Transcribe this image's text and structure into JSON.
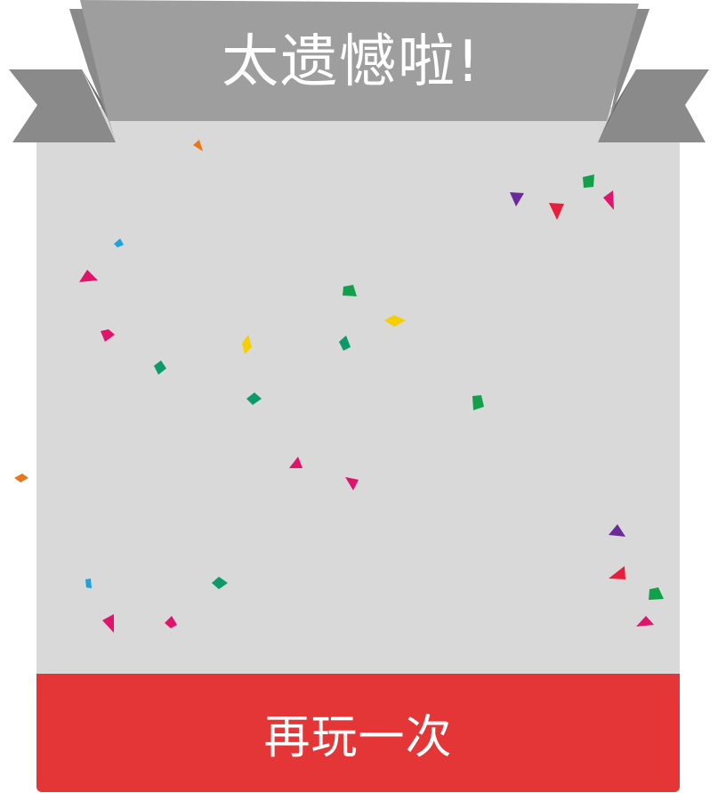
{
  "dialog": {
    "title": "太遗憾啦!",
    "retry_label": "再玩一次"
  },
  "colors": {
    "card_background": "#d9d9d9",
    "ribbon_main": "#9e9e9e",
    "ribbon_tail": "#8a8a8a",
    "button": "#e53637",
    "text": "#ffffff"
  },
  "confetti_colors": [
    "#e8761a",
    "#1aa3dd",
    "#e0146b",
    "#f5cf00",
    "#0d9a6b",
    "#6a2a99",
    "#e81f3b",
    "#12a04a"
  ]
}
